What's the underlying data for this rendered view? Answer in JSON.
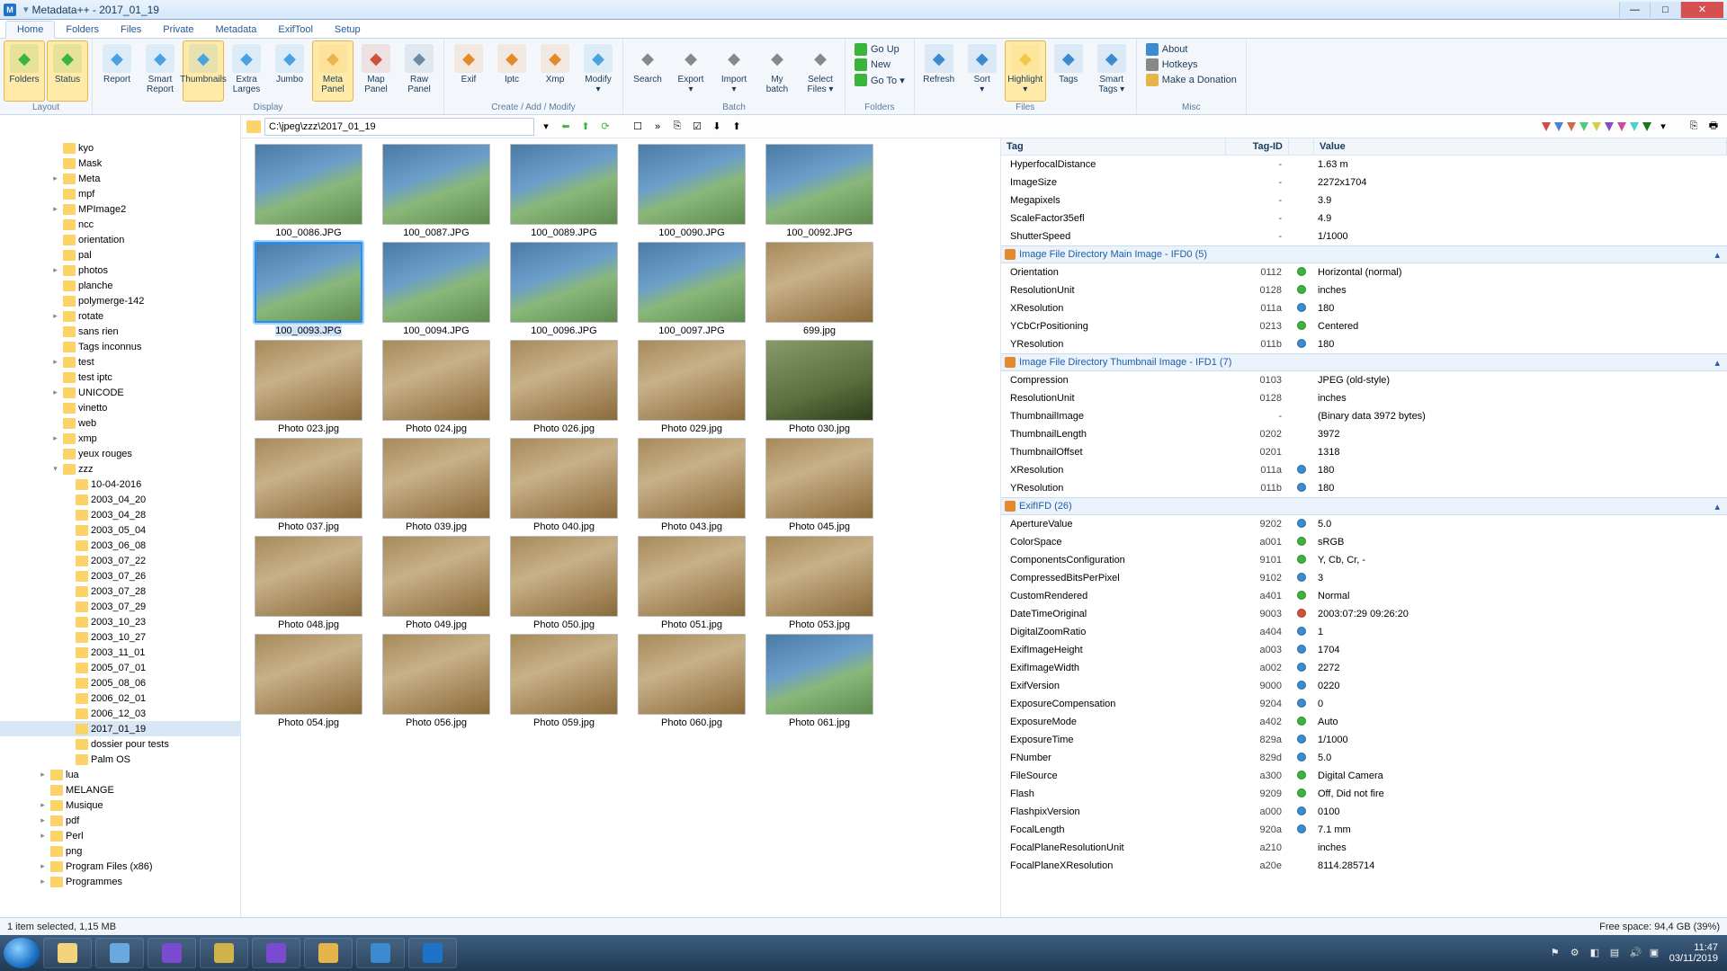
{
  "app": {
    "title": "Metadata++ - 2017_01_19"
  },
  "tabs": [
    "Home",
    "Folders",
    "Files",
    "Private",
    "Metadata",
    "ExifTool",
    "Setup"
  ],
  "activeTab": 0,
  "ribbon": {
    "layout": {
      "label": "Layout",
      "buttons": [
        {
          "id": "folders",
          "label": "Folders",
          "active": true,
          "color": "#3cb33c"
        },
        {
          "id": "status",
          "label": "Status",
          "active": true,
          "color": "#3cb33c"
        }
      ]
    },
    "display": {
      "label": "Display",
      "buttons": [
        {
          "id": "report",
          "label": "Report",
          "color": "#4aa3e0"
        },
        {
          "id": "smart-report",
          "label": "Smart\nReport",
          "color": "#4aa3e0"
        },
        {
          "id": "thumbnails",
          "label": "Thumbnails",
          "active": true,
          "color": "#4aa3e0"
        },
        {
          "id": "extra-larges",
          "label": "Extra\nLarges",
          "color": "#4aa3e0"
        },
        {
          "id": "jumbo",
          "label": "Jumbo",
          "color": "#4aa3e0"
        },
        {
          "id": "meta-panel",
          "label": "Meta\nPanel",
          "active": true,
          "color": "#e8b64a"
        },
        {
          "id": "map-panel",
          "label": "Map\nPanel",
          "color": "#d0503c"
        },
        {
          "id": "raw-panel",
          "label": "Raw\nPanel",
          "color": "#6a8aa5"
        }
      ]
    },
    "cam": {
      "label": "Create / Add / Modify",
      "buttons": [
        {
          "id": "exif",
          "label": "Exif",
          "color": "#e58a2a"
        },
        {
          "id": "iptc",
          "label": "Iptc",
          "color": "#e58a2a"
        },
        {
          "id": "xmp",
          "label": "Xmp",
          "color": "#e58a2a"
        },
        {
          "id": "modify",
          "label": "Modify\n▾",
          "color": "#4aa3e0"
        }
      ]
    },
    "batch": {
      "label": "Batch",
      "buttons": [
        {
          "id": "search",
          "label": "Search",
          "color": "#888"
        },
        {
          "id": "export",
          "label": "Export\n▾",
          "color": "#888"
        },
        {
          "id": "import",
          "label": "Import\n▾",
          "color": "#888"
        },
        {
          "id": "my-batch",
          "label": "My\nbatch",
          "color": "#888"
        },
        {
          "id": "select-files",
          "label": "Select\nFiles ▾",
          "color": "#888"
        }
      ]
    },
    "folders": {
      "label": "Folders",
      "items": [
        {
          "id": "go-up",
          "label": "Go Up",
          "color": "#3cb33c"
        },
        {
          "id": "new",
          "label": "New",
          "color": "#3cb33c"
        },
        {
          "id": "go-to",
          "label": "Go To ▾",
          "color": "#3cb33c"
        }
      ]
    },
    "files": {
      "label": "Files",
      "buttons": [
        {
          "id": "refresh",
          "label": "Refresh",
          "color": "#3c8bd0"
        },
        {
          "id": "sort",
          "label": "Sort\n▾",
          "color": "#3c8bd0"
        },
        {
          "id": "highlight",
          "label": "Highlight\n▾",
          "active": true,
          "color": "#f2c84a"
        },
        {
          "id": "tags",
          "label": "Tags",
          "color": "#3c8bd0"
        },
        {
          "id": "smart-tags",
          "label": "Smart\nTags ▾",
          "color": "#3c8bd0"
        }
      ]
    },
    "misc": {
      "label": "Misc",
      "items": [
        {
          "id": "about",
          "label": "About",
          "color": "#3c8bd0"
        },
        {
          "id": "hotkeys",
          "label": "Hotkeys",
          "color": "#888"
        },
        {
          "id": "donate",
          "label": "Make a Donation",
          "color": "#e5b44a"
        }
      ]
    }
  },
  "path": "C:\\jpeg\\zzz\\2017_01_19",
  "tree": [
    {
      "d": 4,
      "n": "kyo"
    },
    {
      "d": 4,
      "n": "Mask"
    },
    {
      "d": 4,
      "n": "Meta",
      "exp": "▸"
    },
    {
      "d": 4,
      "n": "mpf"
    },
    {
      "d": 4,
      "n": "MPImage2",
      "exp": "▸"
    },
    {
      "d": 4,
      "n": "ncc"
    },
    {
      "d": 4,
      "n": "orientation"
    },
    {
      "d": 4,
      "n": "pal"
    },
    {
      "d": 4,
      "n": "photos",
      "exp": "▸"
    },
    {
      "d": 4,
      "n": "planche"
    },
    {
      "d": 4,
      "n": "polymerge-142"
    },
    {
      "d": 4,
      "n": "rotate",
      "exp": "▸"
    },
    {
      "d": 4,
      "n": "sans rien"
    },
    {
      "d": 4,
      "n": "Tags inconnus"
    },
    {
      "d": 4,
      "n": "test",
      "exp": "▸"
    },
    {
      "d": 4,
      "n": "test iptc"
    },
    {
      "d": 4,
      "n": "UNICODE",
      "exp": "▸"
    },
    {
      "d": 4,
      "n": "vinetto"
    },
    {
      "d": 4,
      "n": "web"
    },
    {
      "d": 4,
      "n": "xmp",
      "exp": "▸"
    },
    {
      "d": 4,
      "n": "yeux rouges"
    },
    {
      "d": 4,
      "n": "zzz",
      "exp": "▾"
    },
    {
      "d": 5,
      "n": "10-04-2016"
    },
    {
      "d": 5,
      "n": "2003_04_20"
    },
    {
      "d": 5,
      "n": "2003_04_28"
    },
    {
      "d": 5,
      "n": "2003_05_04"
    },
    {
      "d": 5,
      "n": "2003_06_08"
    },
    {
      "d": 5,
      "n": "2003_07_22"
    },
    {
      "d": 5,
      "n": "2003_07_26"
    },
    {
      "d": 5,
      "n": "2003_07_28"
    },
    {
      "d": 5,
      "n": "2003_07_29"
    },
    {
      "d": 5,
      "n": "2003_10_23"
    },
    {
      "d": 5,
      "n": "2003_10_27"
    },
    {
      "d": 5,
      "n": "2003_11_01"
    },
    {
      "d": 5,
      "n": "2005_07_01"
    },
    {
      "d": 5,
      "n": "2005_08_06"
    },
    {
      "d": 5,
      "n": "2006_02_01"
    },
    {
      "d": 5,
      "n": "2006_12_03"
    },
    {
      "d": 5,
      "n": "2017_01_19",
      "sel": true
    },
    {
      "d": 5,
      "n": "dossier pour tests"
    },
    {
      "d": 5,
      "n": "Palm OS"
    },
    {
      "d": 3,
      "n": "lua",
      "exp": "▸"
    },
    {
      "d": 3,
      "n": "MELANGE"
    },
    {
      "d": 3,
      "n": "Musique",
      "exp": "▸"
    },
    {
      "d": 3,
      "n": "pdf",
      "exp": "▸"
    },
    {
      "d": 3,
      "n": "Perl",
      "exp": "▸"
    },
    {
      "d": 3,
      "n": "png"
    },
    {
      "d": 3,
      "n": "Program Files (x86)",
      "exp": "▸"
    },
    {
      "d": 3,
      "n": "Programmes",
      "exp": "▸"
    }
  ],
  "thumbs": [
    {
      "n": "100_0086.JPG"
    },
    {
      "n": "100_0087.JPG"
    },
    {
      "n": "100_0089.JPG"
    },
    {
      "n": "100_0090.JPG"
    },
    {
      "n": "100_0092.JPG"
    },
    {
      "n": "100_0093.JPG",
      "sel": true
    },
    {
      "n": "100_0094.JPG"
    },
    {
      "n": "100_0096.JPG"
    },
    {
      "n": "100_0097.JPG"
    },
    {
      "n": "699.jpg",
      "v": 2
    },
    {
      "n": "Photo 023.jpg",
      "v": 2
    },
    {
      "n": "Photo 024.jpg",
      "v": 2
    },
    {
      "n": "Photo 026.jpg",
      "v": 2
    },
    {
      "n": "Photo 029.jpg",
      "v": 2
    },
    {
      "n": "Photo 030.jpg",
      "v": 3
    },
    {
      "n": "Photo 037.jpg",
      "v": 2
    },
    {
      "n": "Photo 039.jpg",
      "v": 2
    },
    {
      "n": "Photo 040.jpg",
      "v": 2
    },
    {
      "n": "Photo 043.jpg",
      "v": 2
    },
    {
      "n": "Photo 045.jpg",
      "v": 2
    },
    {
      "n": "Photo 048.jpg",
      "v": 2
    },
    {
      "n": "Photo 049.jpg",
      "v": 2
    },
    {
      "n": "Photo 050.jpg",
      "v": 2
    },
    {
      "n": "Photo 051.jpg",
      "v": 2
    },
    {
      "n": "Photo 053.jpg",
      "v": 2
    },
    {
      "n": "Photo 054.jpg",
      "v": 2
    },
    {
      "n": "Photo 056.jpg",
      "v": 2
    },
    {
      "n": "Photo 059.jpg",
      "v": 2
    },
    {
      "n": "Photo 060.jpg",
      "v": 2
    },
    {
      "n": "Photo 061.jpg"
    }
  ],
  "metaHead": {
    "tag": "Tag",
    "id": "Tag-ID",
    "val": "Value"
  },
  "meta": [
    {
      "t": "HyperfocalDistance",
      "i": "-",
      "v": "1.63 m"
    },
    {
      "t": "ImageSize",
      "i": "-",
      "v": "2272x1704"
    },
    {
      "t": "Megapixels",
      "i": "-",
      "v": "3.9"
    },
    {
      "t": "ScaleFactor35efl",
      "i": "-",
      "v": "4.9"
    },
    {
      "t": "ShutterSpeed",
      "i": "-",
      "v": "1/1000"
    },
    {
      "section": "Image File Directory Main Image - IFD0  (5)"
    },
    {
      "t": "Orientation",
      "i": "0112",
      "c": "green",
      "v": "Horizontal (normal)"
    },
    {
      "t": "ResolutionUnit",
      "i": "0128",
      "c": "green",
      "v": "inches"
    },
    {
      "t": "XResolution",
      "i": "011a",
      "c": "blue",
      "v": "180"
    },
    {
      "t": "YCbCrPositioning",
      "i": "0213",
      "c": "green",
      "v": "Centered"
    },
    {
      "t": "YResolution",
      "i": "011b",
      "c": "blue",
      "v": "180"
    },
    {
      "section": "Image File Directory Thumbnail Image - IFD1  (7)"
    },
    {
      "t": "Compression",
      "i": "0103",
      "v": "JPEG (old-style)"
    },
    {
      "t": "ResolutionUnit",
      "i": "0128",
      "v": "inches"
    },
    {
      "t": "ThumbnailImage",
      "i": "-",
      "v": "(Binary data 3972 bytes)"
    },
    {
      "t": "ThumbnailLength",
      "i": "0202",
      "v": "3972"
    },
    {
      "t": "ThumbnailOffset",
      "i": "0201",
      "v": "1318"
    },
    {
      "t": "XResolution",
      "i": "011a",
      "c": "blue",
      "v": "180"
    },
    {
      "t": "YResolution",
      "i": "011b",
      "c": "blue",
      "v": "180"
    },
    {
      "section": "ExifIFD  (26)"
    },
    {
      "t": "ApertureValue",
      "i": "9202",
      "c": "blue",
      "v": "5.0"
    },
    {
      "t": "ColorSpace",
      "i": "a001",
      "c": "green",
      "v": "sRGB"
    },
    {
      "t": "ComponentsConfiguration",
      "i": "9101",
      "c": "green",
      "v": "Y, Cb, Cr, -"
    },
    {
      "t": "CompressedBitsPerPixel",
      "i": "9102",
      "c": "blue",
      "v": "3"
    },
    {
      "t": "CustomRendered",
      "i": "a401",
      "c": "green",
      "v": "Normal"
    },
    {
      "t": "DateTimeOriginal",
      "i": "9003",
      "c": "red",
      "v": "2003:07:29 09:26:20"
    },
    {
      "t": "DigitalZoomRatio",
      "i": "a404",
      "c": "blue",
      "v": "1"
    },
    {
      "t": "ExifImageHeight",
      "i": "a003",
      "c": "blue",
      "v": "1704"
    },
    {
      "t": "ExifImageWidth",
      "i": "a002",
      "c": "blue",
      "v": "2272"
    },
    {
      "t": "ExifVersion",
      "i": "9000",
      "c": "blue",
      "v": "0220"
    },
    {
      "t": "ExposureCompensation",
      "i": "9204",
      "c": "blue",
      "v": "0"
    },
    {
      "t": "ExposureMode",
      "i": "a402",
      "c": "green",
      "v": "Auto"
    },
    {
      "t": "ExposureTime",
      "i": "829a",
      "c": "blue",
      "v": "1/1000"
    },
    {
      "t": "FNumber",
      "i": "829d",
      "c": "blue",
      "v": "5.0"
    },
    {
      "t": "FileSource",
      "i": "a300",
      "c": "green",
      "v": "Digital Camera"
    },
    {
      "t": "Flash",
      "i": "9209",
      "c": "green",
      "v": "Off, Did not fire"
    },
    {
      "t": "FlashpixVersion",
      "i": "a000",
      "c": "blue",
      "v": "0100"
    },
    {
      "t": "FocalLength",
      "i": "920a",
      "c": "blue",
      "v": "7.1 mm"
    },
    {
      "t": "FocalPlaneResolutionUnit",
      "i": "a210",
      "v": "inches"
    },
    {
      "t": "FocalPlaneXResolution",
      "i": "a20e",
      "v": "8114.285714"
    }
  ],
  "status": {
    "left": "1 item selected, 1,15 MB",
    "right": "Free space: 94,4 GB  (39%)"
  },
  "clock": {
    "time": "11:47",
    "date": "03/11/2019"
  },
  "arrowColors": [
    "#d04a4a",
    "#4a82d0",
    "#d06a4a",
    "#4ad07a",
    "#d0d04a",
    "#8a4ad0",
    "#d04a9a",
    "#4ad0d0",
    "#177a17"
  ]
}
